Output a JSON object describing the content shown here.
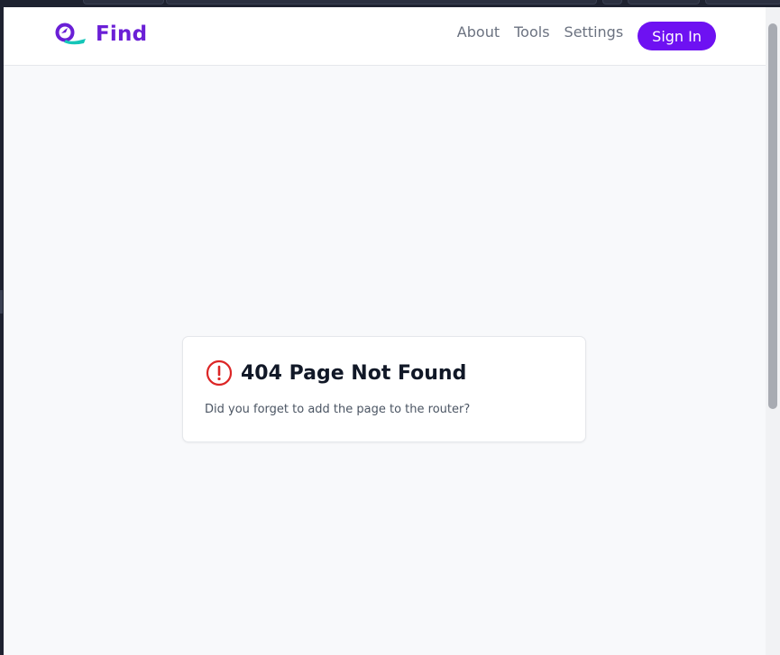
{
  "window": {
    "background": "#1e2230"
  },
  "navbar": {
    "brand": {
      "name": "Find",
      "logo_icon": "magnifier-logo-icon",
      "color": "#6a1fd6"
    },
    "links": [
      {
        "label": "About"
      },
      {
        "label": "Tools"
      },
      {
        "label": "Settings"
      }
    ],
    "signin_label": "Sign In",
    "accent": "#6e11f2"
  },
  "error_card": {
    "icon": "alert-circle-icon",
    "icon_color": "#dc2626",
    "title": "404 Page Not Found",
    "message": "Did you forget to add the page to the router?"
  }
}
